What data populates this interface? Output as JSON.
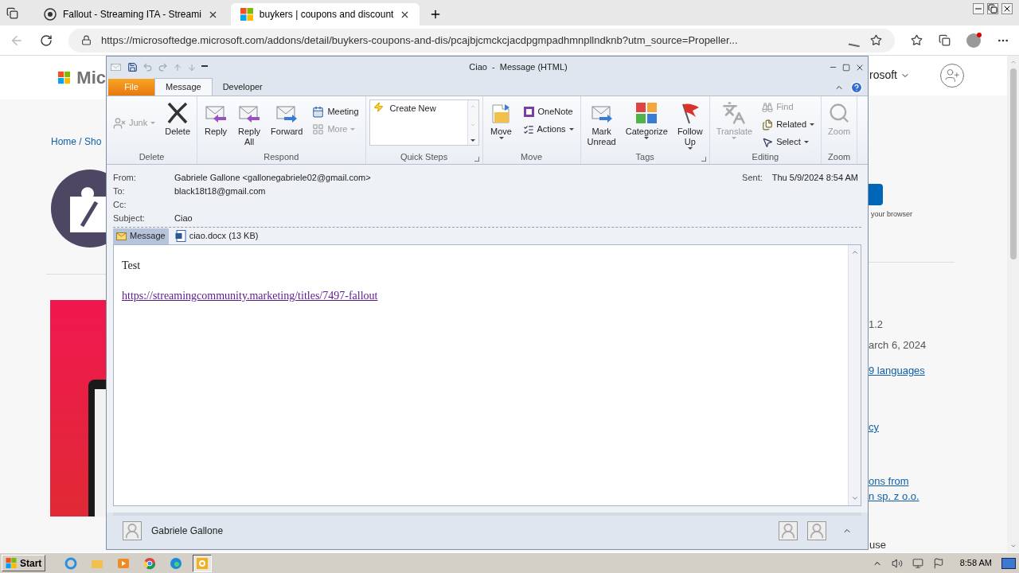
{
  "browser": {
    "tabs": [
      {
        "title": "Fallout - Streaming ITA - Streami",
        "selected": false
      },
      {
        "title": "buykers | coupons and discount",
        "selected": true
      }
    ],
    "address": {
      "url": "https://microsoftedge.microsoft.com/addons/detail/buykers-coupons-and-dis/pcajbjcmckcjacdpgmpadhmnpllndknb?utm_source=Propeller..."
    },
    "page": {
      "brand": "Mic",
      "account_menu": "rosoft",
      "breadcrumb": "Home / Sho",
      "button_caption": "your browser",
      "details": [
        {
          "kind": "text",
          "text": "1.2"
        },
        {
          "kind": "text",
          "text": "arch 6, 2024"
        },
        {
          "kind": "link",
          "text": "9 languages"
        },
        {
          "kind": "link",
          "text": "cy"
        },
        {
          "kind": "link",
          "text": "ons from"
        },
        {
          "kind": "link",
          "text": "n sp. z o.o."
        }
      ],
      "footer": "use"
    }
  },
  "outlook": {
    "title": "Ciao  -  Message (HTML)",
    "tabs": [
      {
        "label": "File",
        "kind": "backstage",
        "selected": false
      },
      {
        "label": "Message",
        "kind": "tab",
        "selected": true
      },
      {
        "label": "Developer",
        "kind": "tab",
        "selected": false
      }
    ],
    "groups": [
      {
        "label": "Delete",
        "launcher": false,
        "items": [
          {
            "kind": "small",
            "label": "Junk",
            "disabled": true,
            "dropdown": true
          },
          {
            "kind": "large",
            "label": "Delete",
            "disabled": false,
            "dropdown": false
          }
        ]
      },
      {
        "label": "Respond",
        "launcher": false,
        "items": [
          {
            "kind": "large",
            "label": "Reply",
            "disabled": false,
            "dropdown": false
          },
          {
            "kind": "large",
            "label": "Reply All",
            "disabled": false,
            "dropdown": false
          },
          {
            "kind": "large",
            "label": "Forward",
            "disabled": false,
            "dropdown": false
          },
          {
            "kind": "small",
            "label": "Meeting",
            "disabled": false,
            "dropdown": false
          },
          {
            "kind": "small",
            "label": "More",
            "disabled": true,
            "dropdown": true
          }
        ]
      },
      {
        "label": "Quick Steps",
        "launcher": true,
        "items": [
          {
            "kind": "gallery",
            "label": "Create New",
            "disabled": false
          }
        ]
      },
      {
        "label": "Move",
        "launcher": false,
        "items": [
          {
            "kind": "large",
            "label": "Move",
            "disabled": false,
            "dropdown": true
          },
          {
            "kind": "small",
            "label": "OneNote",
            "disabled": false,
            "dropdown": false
          },
          {
            "kind": "small",
            "label": "Actions",
            "disabled": false,
            "dropdown": true
          }
        ]
      },
      {
        "label": "Tags",
        "launcher": true,
        "items": [
          {
            "kind": "large",
            "label": "Mark Unread",
            "disabled": false,
            "dropdown": false
          },
          {
            "kind": "large",
            "label": "Categorize",
            "disabled": false,
            "dropdown": true
          },
          {
            "kind": "large",
            "label": "Follow Up",
            "disabled": false,
            "dropdown": true
          }
        ]
      },
      {
        "label": "Editing",
        "launcher": false,
        "items": [
          {
            "kind": "large",
            "label": "Translate",
            "disabled": true,
            "dropdown": true
          },
          {
            "kind": "small",
            "label": "Find",
            "disabled": true,
            "dropdown": false
          },
          {
            "kind": "small",
            "label": "Related",
            "disabled": false,
            "dropdown": true
          },
          {
            "kind": "small",
            "label": "Select",
            "disabled": false,
            "dropdown": true
          }
        ]
      },
      {
        "label": "Zoom",
        "launcher": false,
        "items": [
          {
            "kind": "large",
            "label": "Zoom",
            "disabled": true,
            "dropdown": false
          }
        ]
      }
    ],
    "header": {
      "fields": [
        {
          "label": "From:",
          "value": "Gabriele Gallone <gallonegabriele02@gmail.com>"
        },
        {
          "label": "To:",
          "value": "black18t18@gmail.com"
        },
        {
          "label": "Cc:"
        },
        {
          "label": "Subject:",
          "value": "Ciao"
        }
      ],
      "sent": {
        "label": "Sent:",
        "value": "Thu 5/9/2024 8:54 AM"
      }
    },
    "attachments": [
      {
        "kind": "message",
        "label": "Message",
        "selected": true
      },
      {
        "kind": "file",
        "label": "ciao.docx (13 KB)",
        "selected": false
      }
    ],
    "body": [
      {
        "kind": "text",
        "text": "Test"
      },
      {
        "kind": "link",
        "text": "https://streamingcommunity.marketing/titles/7497-fallout"
      }
    ],
    "people": {
      "name": "Gabriele Gallone"
    }
  },
  "taskbar": {
    "start": "Start",
    "apps": [
      {
        "selected": false
      },
      {
        "selected": false
      },
      {
        "selected": false
      },
      {
        "selected": false
      },
      {
        "selected": false
      },
      {
        "selected": true
      }
    ],
    "clock": "8:58 AM"
  }
}
